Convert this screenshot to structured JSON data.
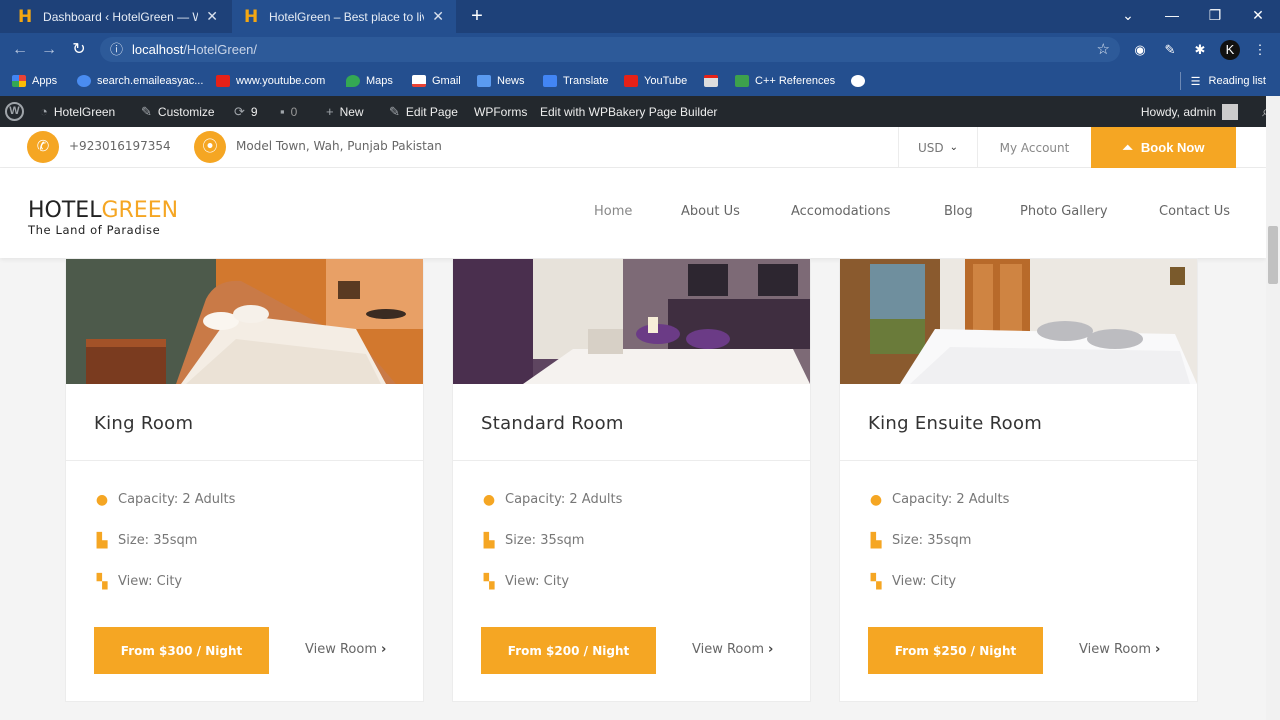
{
  "browser": {
    "tabs": [
      {
        "title": "Dashboard ‹ HotelGreen — Word",
        "active": false
      },
      {
        "title": "HotelGreen – Best place to live",
        "active": true
      }
    ],
    "address": {
      "host": "localhost",
      "path": "/HotelGreen/"
    },
    "bookmarks": [
      "Apps",
      "search.emaileasyac...",
      "www.youtube.com",
      "Maps",
      "Gmail",
      "News",
      "Translate",
      "YouTube",
      "C++ References"
    ],
    "reading_list": "Reading list"
  },
  "wp_admin_bar": {
    "site": "HotelGreen",
    "customize": "Customize",
    "updates": "9",
    "comments": "0",
    "new": "New",
    "edit_page": "Edit Page",
    "wpforms": "WPForms",
    "wpbakery": "Edit with WPBakery Page Builder",
    "howdy": "Howdy, admin"
  },
  "top_info": {
    "phone": "+923016197354",
    "address": "Model Town, Wah, Punjab Pakistan",
    "currency": "USD",
    "my_account": "My Account",
    "book_now": "Book Now"
  },
  "header": {
    "logo_main_1": "HOTEL",
    "logo_main_2": "GREEN",
    "logo_tagline": "The Land of Paradise",
    "nav": [
      "Home",
      "About Us",
      "Accomodations",
      "Blog",
      "Photo Gallery",
      "Contact Us"
    ]
  },
  "rooms": [
    {
      "name": "King Room",
      "capacity": "Capacity: 2 Adults",
      "size": "Size: 35sqm",
      "view": "View: City",
      "price": "From $300 / Night",
      "view_room": "View Room"
    },
    {
      "name": "Standard Room",
      "capacity": "Capacity: 2 Adults",
      "size": "Size: 35sqm",
      "view": "View: City",
      "price": "From $200 / Night",
      "view_room": "View Room"
    },
    {
      "name": "King Ensuite Room",
      "capacity": "Capacity: 2 Adults",
      "size": "Size: 35sqm",
      "view": "View: City",
      "price": "From $250 / Night",
      "view_room": "View Room"
    }
  ],
  "colors": {
    "accent": "#f5a623",
    "chrome": "#244f8f",
    "wpbar": "#23282d"
  }
}
